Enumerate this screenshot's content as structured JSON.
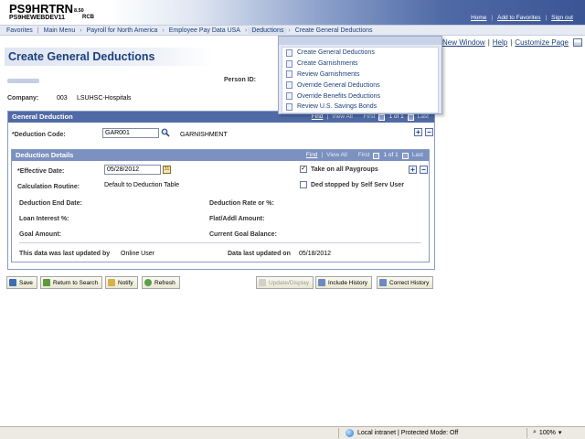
{
  "header": {
    "title": "PS9HRTRN",
    "version": "8.50",
    "db": "PS9HEWEBDEV11",
    "db_suffix": "RCB",
    "links": [
      "Home",
      "Add to Favorites",
      "Sign out"
    ]
  },
  "nav": {
    "items": [
      "Favorites",
      "Main Menu",
      "Payroll for North America",
      "Employee Pay Data USA",
      "Deductions",
      "Create General Deductions"
    ]
  },
  "pagelinks": {
    "new_window": "New Window",
    "help": "Help",
    "customize": "Customize Page"
  },
  "page": {
    "title": "Create General Deductions",
    "person_id_label": "Person ID:",
    "company_label": "Company:",
    "company_code": "003",
    "company_name": "LSUHSC-Hospitals"
  },
  "general_deduction": {
    "header": "General Deduction",
    "nav": {
      "find": "Find",
      "view_all": "View All",
      "first": "First",
      "count": "1 of 1",
      "last": "Last"
    },
    "deduction_code_label": "*Deduction Code:",
    "deduction_code_value": "GAR001",
    "deduction_code_desc": "GARNISHMENT"
  },
  "deduction_details": {
    "header": "Deduction Details",
    "nav": {
      "find": "Find",
      "view_all": "View All",
      "first": "First",
      "count": "1 of 1",
      "last": "Last"
    },
    "effective_date_label": "*Effective Date:",
    "effective_date_value": "05/28/2012",
    "take_on_all_paygroups": "Take on all Paygroups",
    "take_on_all_checked": true,
    "ded_stopped": "Ded stopped by Self Serv User",
    "ded_stopped_checked": false,
    "calc_routine_label": "Calculation Routine:",
    "calc_routine_value": "Default to Deduction Table",
    "end_date_label": "Deduction End Date:",
    "rate_label": "Deduction Rate or %:",
    "loan_interest_label": "Loan Interest %:",
    "flat_amount_label": "Flat/Addl Amount:",
    "goal_amount_label": "Goal Amount:",
    "current_goal_label": "Current Goal Balance:",
    "updated_by_label": "This data was last updated by",
    "updated_by_value": "Online User",
    "updated_on_label": "Data last updated on",
    "updated_on_value": "05/18/2012"
  },
  "buttons": {
    "save": "Save",
    "return_to_search": "Return to Search",
    "notify": "Notify",
    "refresh": "Refresh",
    "update_display": "Update/Display",
    "include_history": "Include History",
    "correct_history": "Correct History"
  },
  "dropdown": {
    "items": [
      "Create General Deductions",
      "Create Garnishments",
      "Review Garnishments",
      "Override General Deductions",
      "Override Benefits Deductions",
      "Review U.S. Savings Bonds"
    ]
  },
  "status": {
    "zone": "Local intranet | Protected Mode: Off",
    "zoom": "100%"
  },
  "colors": {
    "accent": "#4f6aa6",
    "link": "#1c3f7c",
    "subheader": "#7c91bf"
  }
}
